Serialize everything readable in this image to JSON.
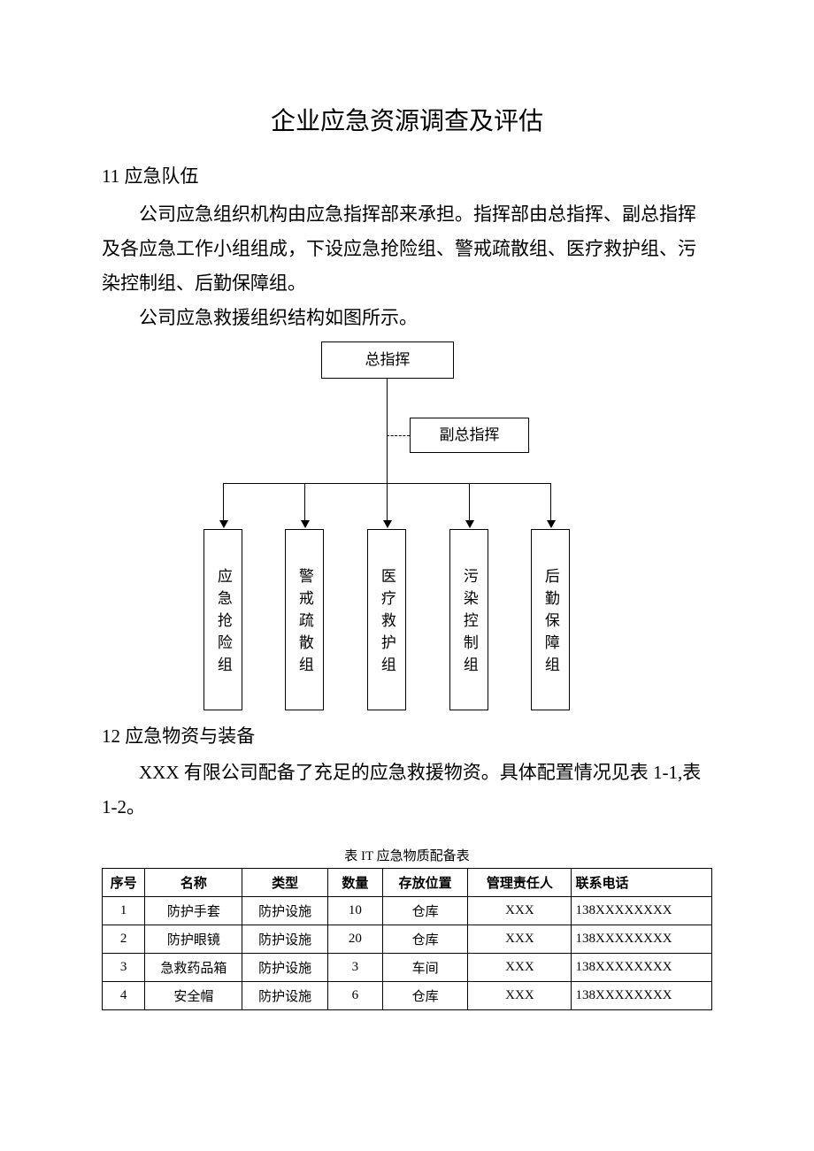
{
  "title": "企业应急资源调查及评估",
  "section1": {
    "heading": "11 应急队伍",
    "p1": "公司应急组织机构由应急指挥部来承担。指挥部由总指挥、副总指挥及各应急工作小组组成，下设应急抢险组、警戒疏散组、医疗救护组、污染控制组、后勤保障组。",
    "p2": "公司应急救援组织结构如图所示。"
  },
  "org_chart": {
    "top": "总指挥",
    "vice": "副总指挥",
    "leaves": [
      "应急抢险组",
      "警戒疏散组",
      "医疗救护组",
      "污染控制组",
      "后勤保障组"
    ]
  },
  "section2": {
    "heading": "12 应急物资与装备",
    "p1": "XXX 有限公司配备了充足的应急救援物资。具体配置情况见表 1-1,表 1-2。"
  },
  "table1": {
    "caption": "表 IT 应急物质配备表",
    "headers": [
      "序号",
      "名称",
      "类型",
      "数量",
      "存放位置",
      "管理责任人",
      "联系电话"
    ],
    "rows": [
      {
        "seq": "1",
        "name": "防护手套",
        "type": "防护设施",
        "qty": "10",
        "loc": "仓库",
        "mgr": "XXX",
        "tel": "138XXXXXXXX"
      },
      {
        "seq": "2",
        "name": "防护眼镜",
        "type": "防护设施",
        "qty": "20",
        "loc": "仓库",
        "mgr": "XXX",
        "tel": "138XXXXXXXX"
      },
      {
        "seq": "3",
        "name": "急救药品箱",
        "type": "防护设施",
        "qty": "3",
        "loc": "车间",
        "mgr": "XXX",
        "tel": "138XXXXXXXX"
      },
      {
        "seq": "4",
        "name": "安全帽",
        "type": "防护设施",
        "qty": "6",
        "loc": "仓库",
        "mgr": "XXX",
        "tel": "138XXXXXXXX"
      }
    ]
  }
}
